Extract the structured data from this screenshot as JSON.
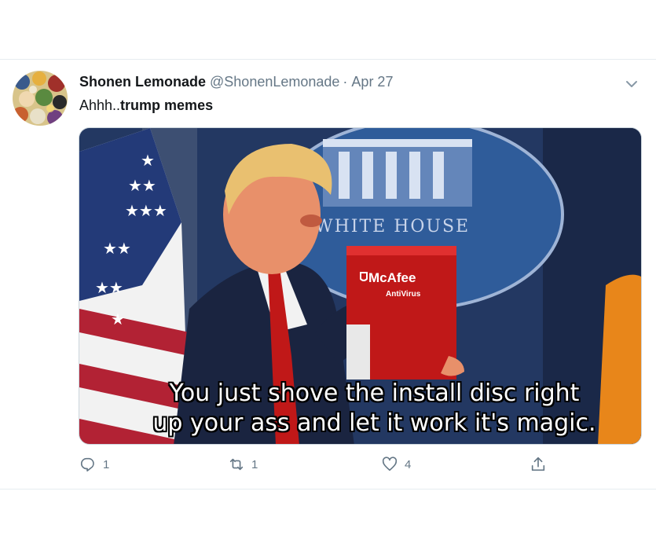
{
  "tweet": {
    "display_name": "Shonen Lemonade",
    "handle": "@ShonenLemonade",
    "separator": "·",
    "date": "Apr 27",
    "text_prefix": "Ahhh..",
    "text_bold": "trump memes",
    "media": {
      "sign_text": "WHITE HOUSE",
      "box_brand": "McAfee",
      "box_product": "AntiVirus",
      "caption_line1": "You just shove the install disc right",
      "caption_line2": "up your ass and let it work it's magic."
    },
    "actions": {
      "reply_count": "1",
      "retweet_count": "1",
      "like_count": "4"
    }
  },
  "colors": {
    "secondary_text": "#657786",
    "divider": "#e6ecf0",
    "mcafee_red": "#c01818"
  },
  "icons": [
    "avatar",
    "chevron-down-icon",
    "reply-icon",
    "retweet-icon",
    "like-icon",
    "share-icon"
  ]
}
